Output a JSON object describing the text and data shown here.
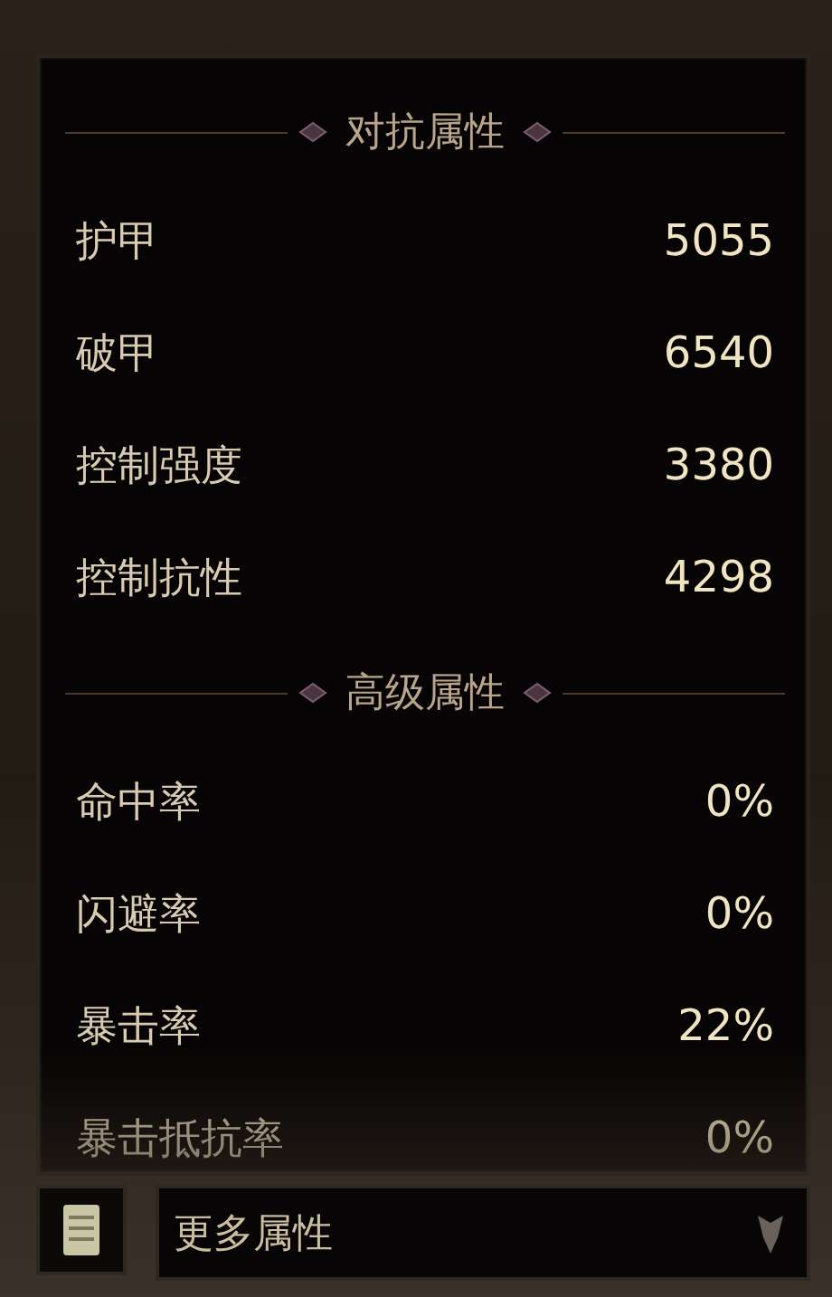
{
  "sections": [
    {
      "title": "对抗属性",
      "rows": [
        {
          "label": "护甲",
          "value": "5055"
        },
        {
          "label": "破甲",
          "value": "6540"
        },
        {
          "label": "控制强度",
          "value": "3380"
        },
        {
          "label": "控制抗性",
          "value": "4298"
        }
      ]
    },
    {
      "title": "高级属性",
      "rows": [
        {
          "label": "命中率",
          "value": "0%"
        },
        {
          "label": "闪避率",
          "value": "0%"
        },
        {
          "label": "暴击率",
          "value": "22%"
        },
        {
          "label": "暴击抵抗率",
          "value": "0%"
        }
      ]
    }
  ],
  "footer": {
    "dropdown": "更多属性"
  }
}
